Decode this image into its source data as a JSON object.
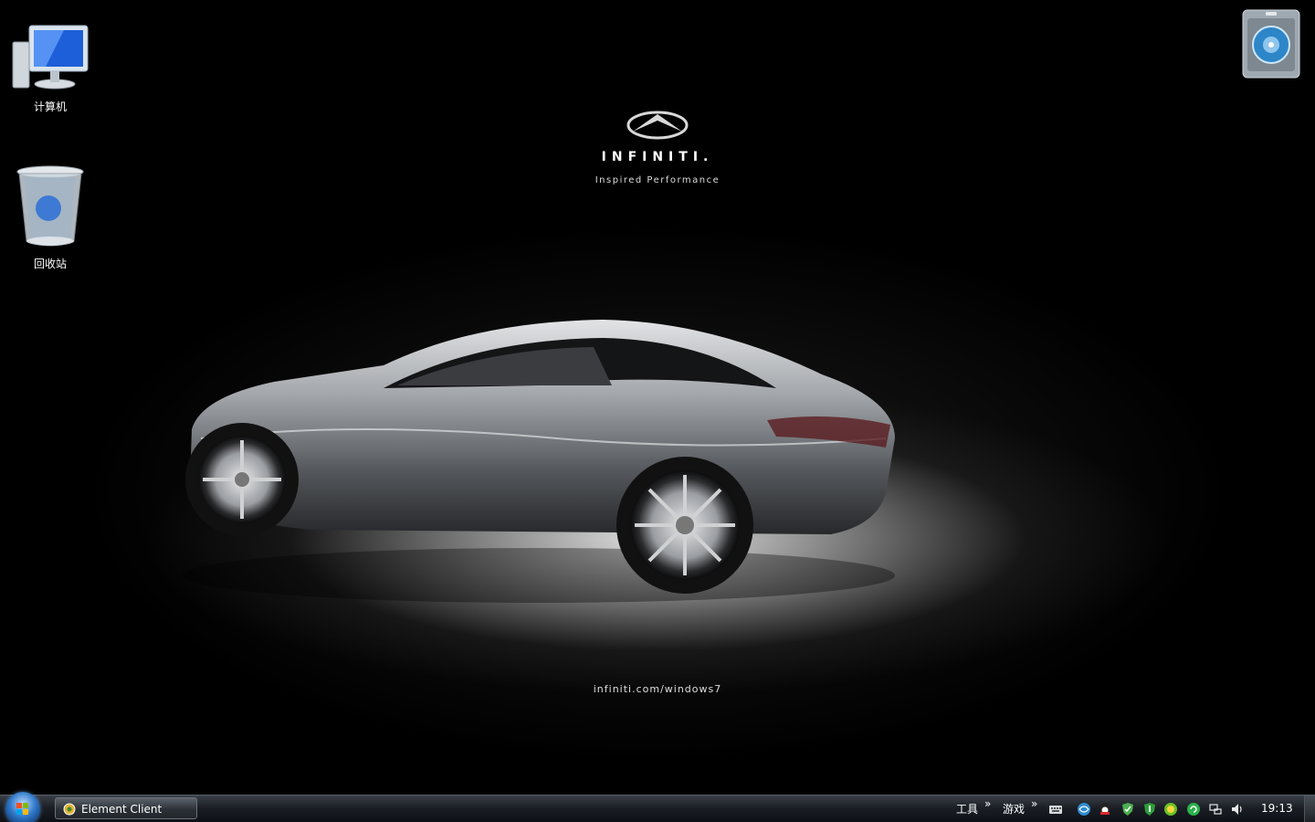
{
  "desktop": {
    "icons": [
      {
        "label": "计算机",
        "icon": "computer-icon"
      },
      {
        "label": "回收站",
        "icon": "recycle-bin-icon"
      }
    ],
    "wallpaper": {
      "brand": "INFINITI.",
      "tagline": "Inspired Performance",
      "url": "infiniti.com/windows7",
      "colors": {
        "background": "#000000",
        "spotlight": "#ffffff",
        "car": "#8a8d91"
      }
    },
    "gadget": {
      "icon": "gadget-disc-icon"
    }
  },
  "taskbar": {
    "start_icon": "windows-orb-icon",
    "tasks": [
      {
        "label": "Element Client",
        "icon": "element-client-icon"
      }
    ],
    "toolbars": [
      {
        "label": "工具"
      },
      {
        "label": "游戏"
      }
    ],
    "chevron": "»",
    "tray_icons": [
      "keyboard-icon",
      "network-globe-icon",
      "qq-icon",
      "shield-icon",
      "security-icon",
      "360-icon",
      "update-icon",
      "network-icon",
      "volume-icon"
    ],
    "clock": "19:13",
    "colors": {
      "accent": "#2f78c9",
      "bar": "#1b1f25"
    }
  }
}
